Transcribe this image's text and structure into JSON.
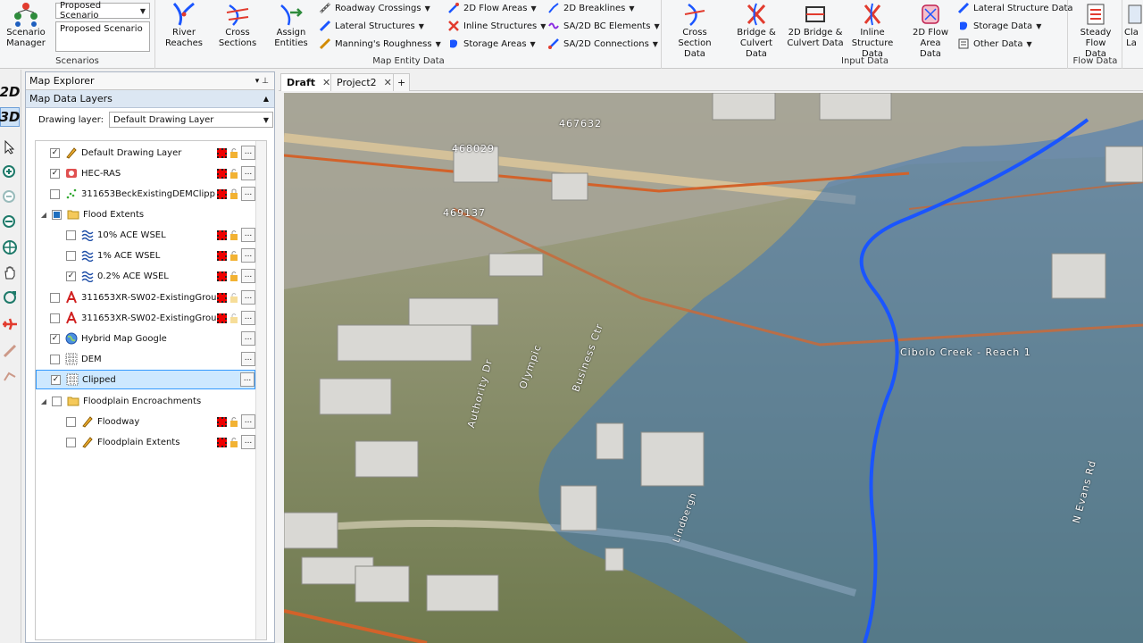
{
  "ribbon": {
    "scenarios": {
      "combo": "Proposed Scenario",
      "list_item": "Proposed Scenario",
      "manager_label": "Scenario Manager",
      "group_label": "Scenarios"
    },
    "map_entity": {
      "group_label": "Map Entity Data",
      "river_reaches": "River Reaches",
      "cross_sections": "Cross Sections",
      "assign_entities": "Assign Entities",
      "roadway_crossings": "Roadway Crossings",
      "lateral_structures": "Lateral Structures",
      "mannings_roughness": "Manning's Roughness",
      "flow_areas_2d": "2D Flow Areas",
      "inline_structures": "Inline Structures",
      "storage_areas": "Storage Areas",
      "breaklines_2d": "2D Breaklines",
      "bc_elements": "SA/2D BC Elements",
      "connections": "SA/2D Connections"
    },
    "input_data": {
      "group_label": "Input Data",
      "cross_section_data": "Cross Section Data",
      "bridge_culvert_data": "Bridge & Culvert Data",
      "bridge_culvert_2d": "2D Bridge & Culvert Data",
      "inline_structure_data": "Inline Structure Data",
      "flow_area_data_2d": "2D Flow Area Data",
      "lateral_structure_data": "Lateral Structure Data",
      "storage_data": "Storage Data",
      "other_data": "Other Data"
    },
    "flow_data": {
      "group_label": "Flow Data",
      "steady_flow_data": "Steady Flow Data",
      "next_partial": "Cla La"
    }
  },
  "lefttools": {
    "btn_2d": "2D",
    "btn_3d": "3D"
  },
  "explorer": {
    "title": "Map Explorer",
    "pin": "▾ ⊥",
    "subtitle": "Map Data Layers",
    "drawing_layer_label": "Drawing layer:",
    "drawing_layer_value": "Default Drawing Layer",
    "layers": [
      {
        "name": "Default Drawing Layer",
        "checked": "✓"
      },
      {
        "name": "HEC-RAS",
        "checked": "✓"
      },
      {
        "name": "311653BeckExistingDEMClipp",
        "checked": ""
      },
      {
        "name": "Flood Extents",
        "checked": "partial",
        "expander": "◢"
      },
      {
        "name": "10% ACE WSEL",
        "checked": ""
      },
      {
        "name": "1% ACE WSEL",
        "checked": ""
      },
      {
        "name": "0.2% ACE WSEL",
        "checked": "✓"
      },
      {
        "name": "311653XR-SW02-ExistingGrou",
        "checked": ""
      },
      {
        "name": "311653XR-SW02-ExistingGrou",
        "checked": ""
      },
      {
        "name": "Hybrid Map Google",
        "checked": "✓"
      },
      {
        "name": "DEM",
        "checked": ""
      },
      {
        "name": "Clipped",
        "checked": "✓"
      },
      {
        "name": "Floodplain Encroachments",
        "checked": "",
        "expander": "◢"
      },
      {
        "name": "Floodway",
        "checked": ""
      },
      {
        "name": "Floodplain Extents",
        "checked": ""
      }
    ],
    "more": "..."
  },
  "tabs": [
    {
      "label": "Draft",
      "close": "✕"
    },
    {
      "label": "Project2",
      "close": "✕"
    },
    {
      "label": "+"
    }
  ],
  "map": {
    "labels": {
      "id1": "467632",
      "id2": "468029",
      "id3": "469137",
      "reach": "Cibolo Creek - Reach 1",
      "road1": "Business Ctr",
      "road2": "Authority Dr",
      "road3": "Olympic",
      "road4": "N Evans Rd",
      "road5": "Lindbergh"
    },
    "colors": {
      "flood": "#3f78b8",
      "reach": "#1a55ff",
      "section_lines": "#d2622a",
      "terrain": "#7f8a5a"
    }
  }
}
